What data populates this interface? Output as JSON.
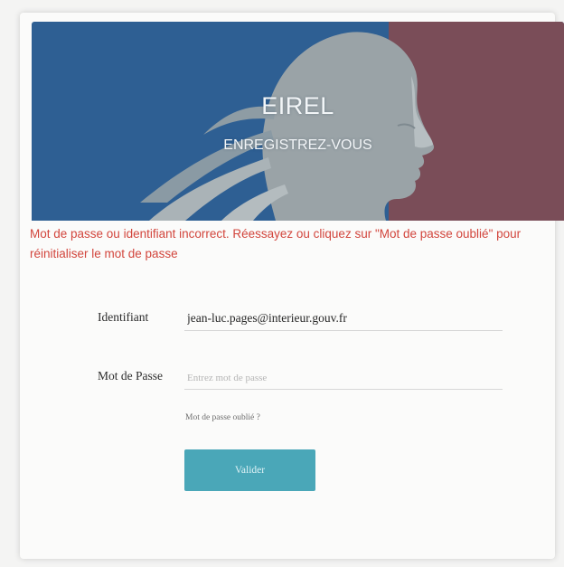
{
  "banner": {
    "title": "EIREL",
    "subtitle": "ENREGISTREZ-VOUS",
    "colors": {
      "blue": "#2e5f93",
      "red": "#7a4d58",
      "center": "#8f9aa0"
    }
  },
  "error": {
    "message": "Mot de passe ou identifiant incorrect. Réessayez ou cliquez sur \"Mot de passe oublié\" pour réinitialiser le mot de passe"
  },
  "form": {
    "username_label": "Identifiant",
    "username_value": "jean-luc.pages@interieur.gouv.fr",
    "password_label": "Mot de Passe",
    "password_placeholder": "Entrez mot de passe",
    "forgot_link": "Mot de passe oublié ?",
    "submit_label": "Valider"
  },
  "colors": {
    "accent": "#4aa7b8",
    "error": "#d2453c"
  }
}
